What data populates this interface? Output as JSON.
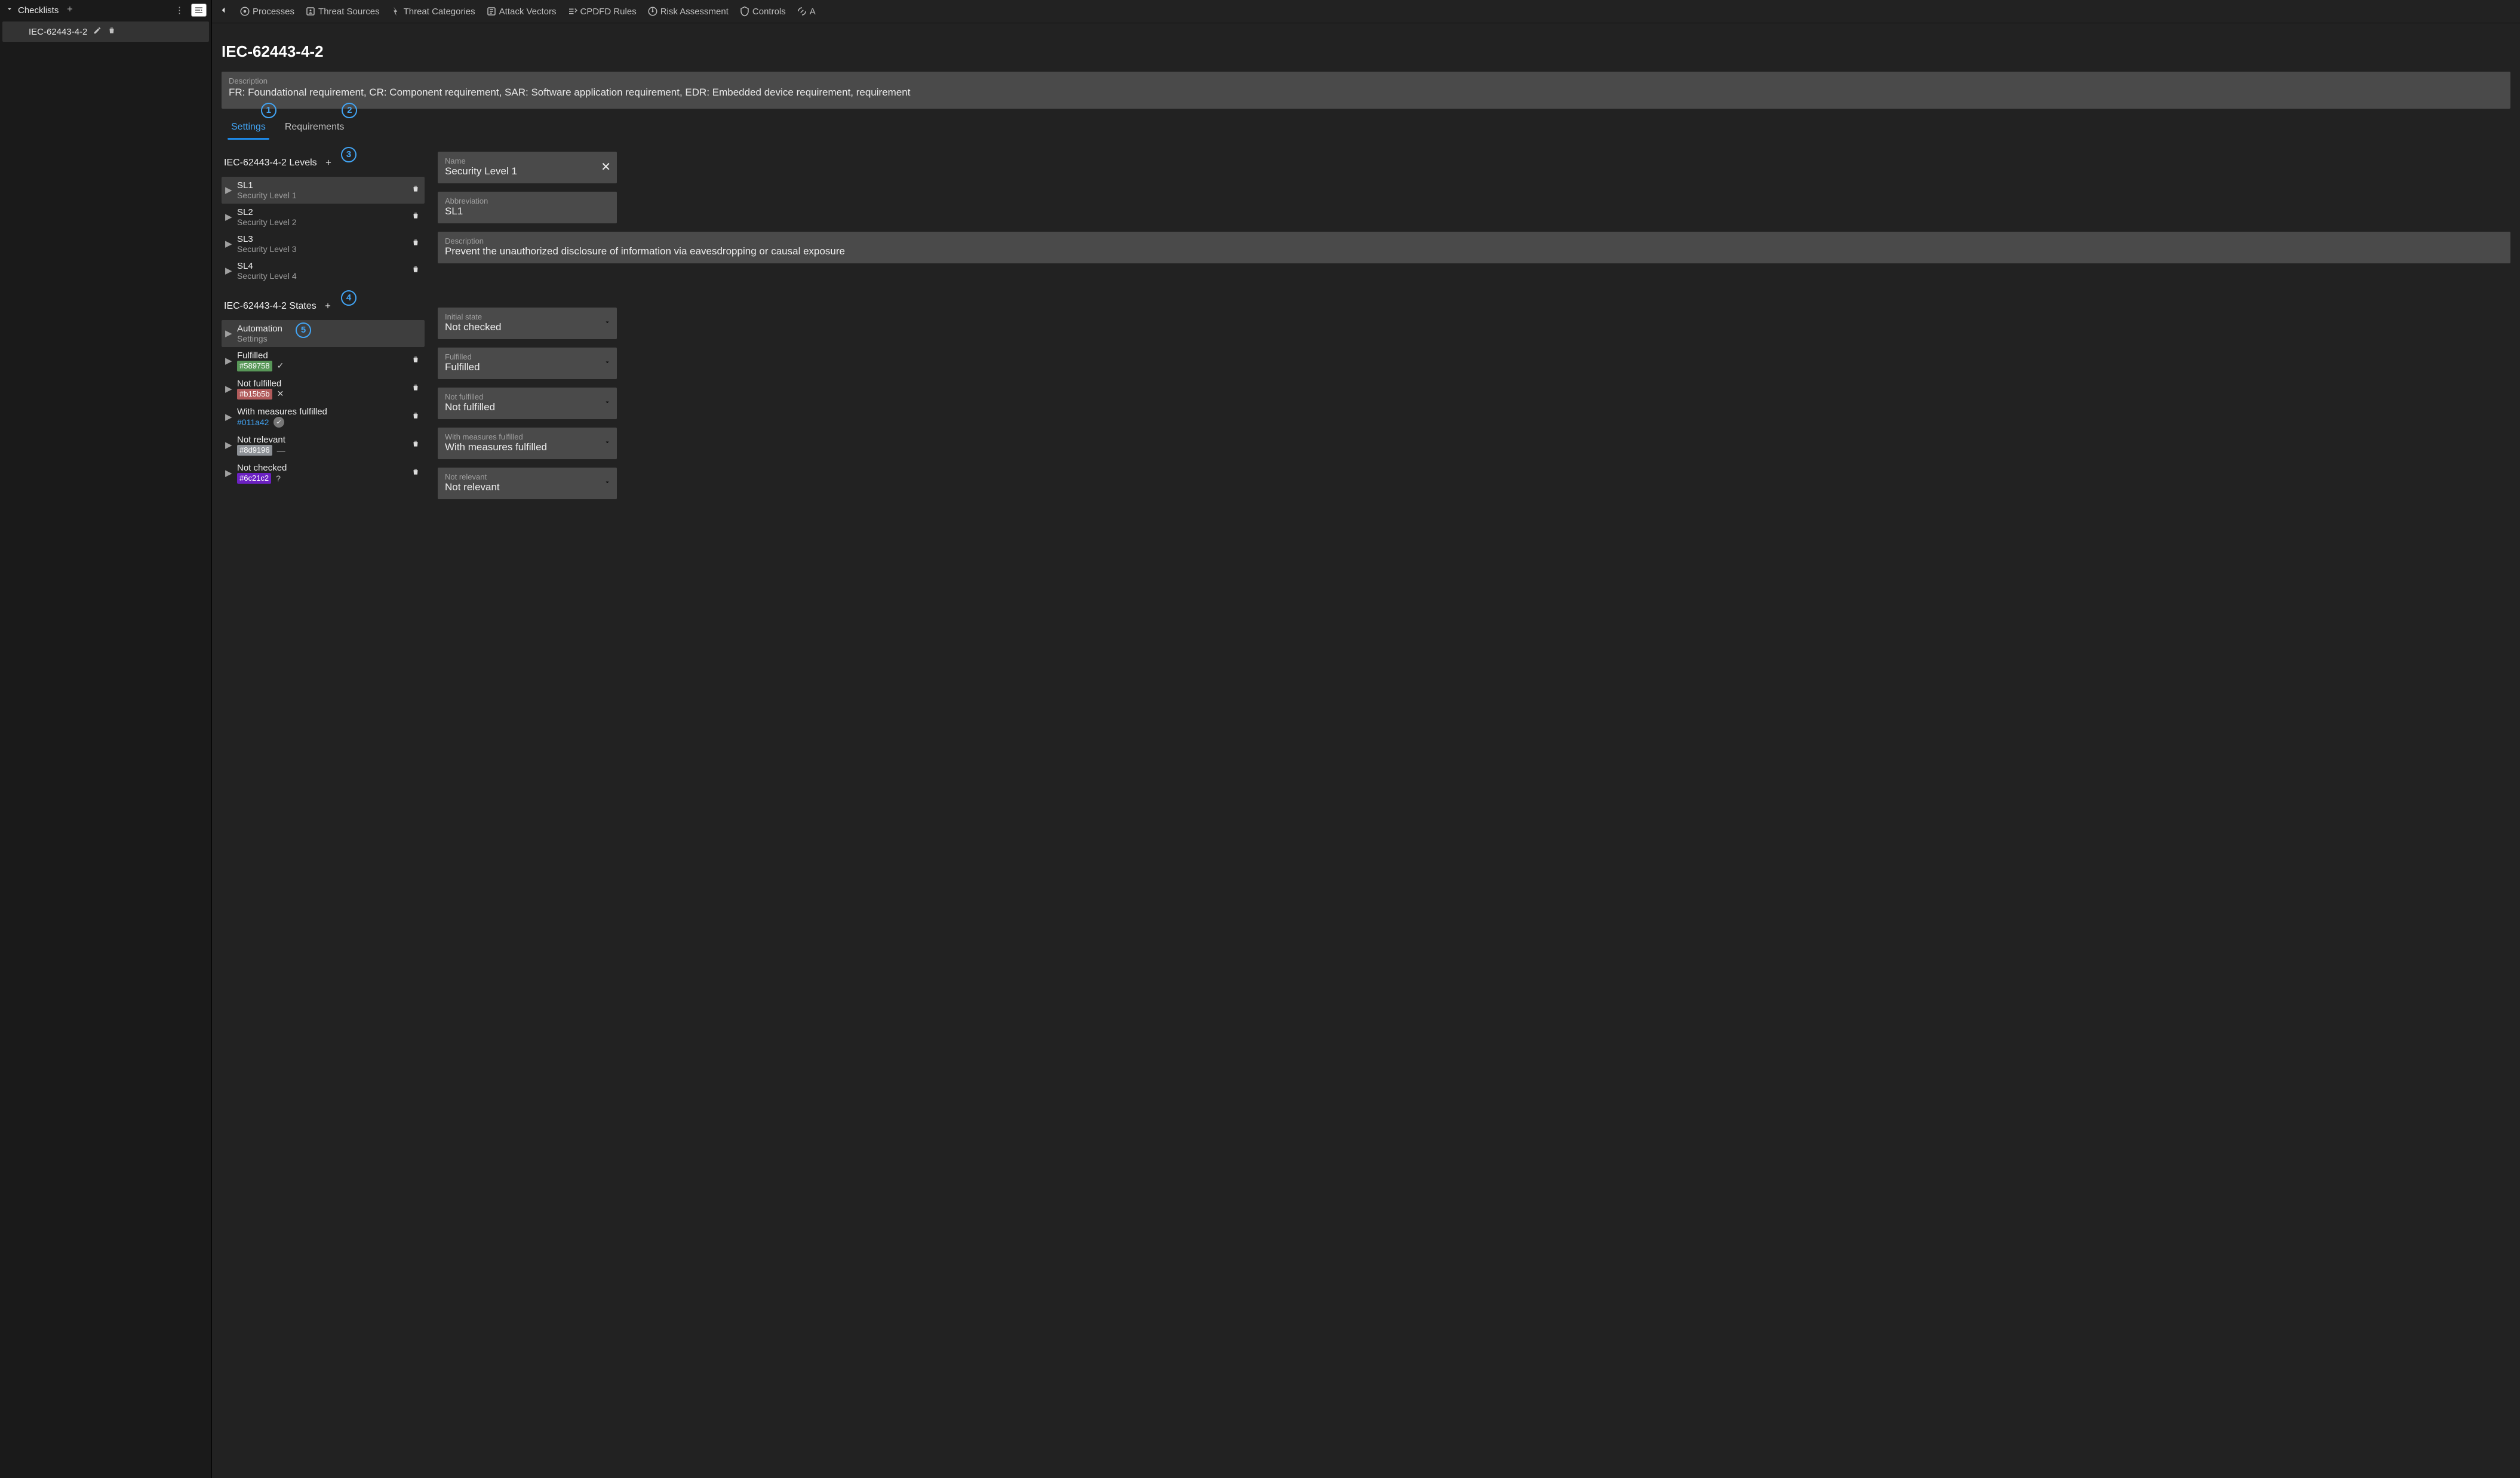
{
  "sidebar": {
    "header": "Checklists",
    "item": "IEC-62443-4-2"
  },
  "nav": {
    "processes": "Processes",
    "threat_sources": "Threat Sources",
    "threat_categories": "Threat Categories",
    "attack_vectors": "Attack Vectors",
    "cpdfd_rules": "CPDFD Rules",
    "risk_assessment": "Risk Assessment",
    "controls": "Controls",
    "more": "A"
  },
  "page": {
    "title": "IEC-62443-4-2",
    "description_label": "Description",
    "description_body": "FR: Foundational requirement, CR: Component requirement, SAR: Software application requirement, EDR: Embedded device requirement, requirement"
  },
  "tabs": {
    "settings": "Settings",
    "requirements": "Requirements"
  },
  "annotations": {
    "a1": "1",
    "a2": "2",
    "a3": "3",
    "a4": "4",
    "a5": "5"
  },
  "levels": {
    "heading": "IEC-62443-4-2 Levels",
    "items": [
      {
        "abbr": "SL1",
        "name": "Security Level 1"
      },
      {
        "abbr": "SL2",
        "name": "Security Level 2"
      },
      {
        "abbr": "SL3",
        "name": "Security Level 3"
      },
      {
        "abbr": "SL4",
        "name": "Security Level 4"
      }
    ]
  },
  "level_form": {
    "name_label": "Name",
    "name_value": "Security Level 1",
    "abbr_label": "Abbreviation",
    "abbr_value": "SL1",
    "desc_label": "Description",
    "desc_value": "Prevent the unauthorized disclosure of information via eavesdropping or causal exposure"
  },
  "states": {
    "heading": "IEC-62443-4-2 States",
    "automation": {
      "title": "Automation",
      "subtitle": "Settings"
    },
    "items": [
      {
        "name": "Fulfilled",
        "hex": "#589758",
        "swatch": "#589758",
        "icon": "check"
      },
      {
        "name": "Not fulfilled",
        "hex": "#b15b5b",
        "swatch": "#b15b5b",
        "icon": "x"
      },
      {
        "name": "With measures fulfilled",
        "hex": "#011a42",
        "swatch": "",
        "icon": "shield"
      },
      {
        "name": "Not relevant",
        "hex": "#8d9196",
        "swatch": "#8d9196",
        "icon": "minus"
      },
      {
        "name": "Not checked",
        "hex": "#6c21c2",
        "swatch": "#6c21c2",
        "icon": "question"
      }
    ]
  },
  "state_form": {
    "initial_label": "Initial state",
    "initial_value": "Not checked",
    "fulfilled_label": "Fulfilled",
    "fulfilled_value": "Fulfilled",
    "notfulfilled_label": "Not fulfilled",
    "notfulfilled_value": "Not fulfilled",
    "withmeasures_label": "With measures fulfilled",
    "withmeasures_value": "With measures fulfilled",
    "notrelevant_label": "Not relevant",
    "notrelevant_value": "Not relevant"
  }
}
